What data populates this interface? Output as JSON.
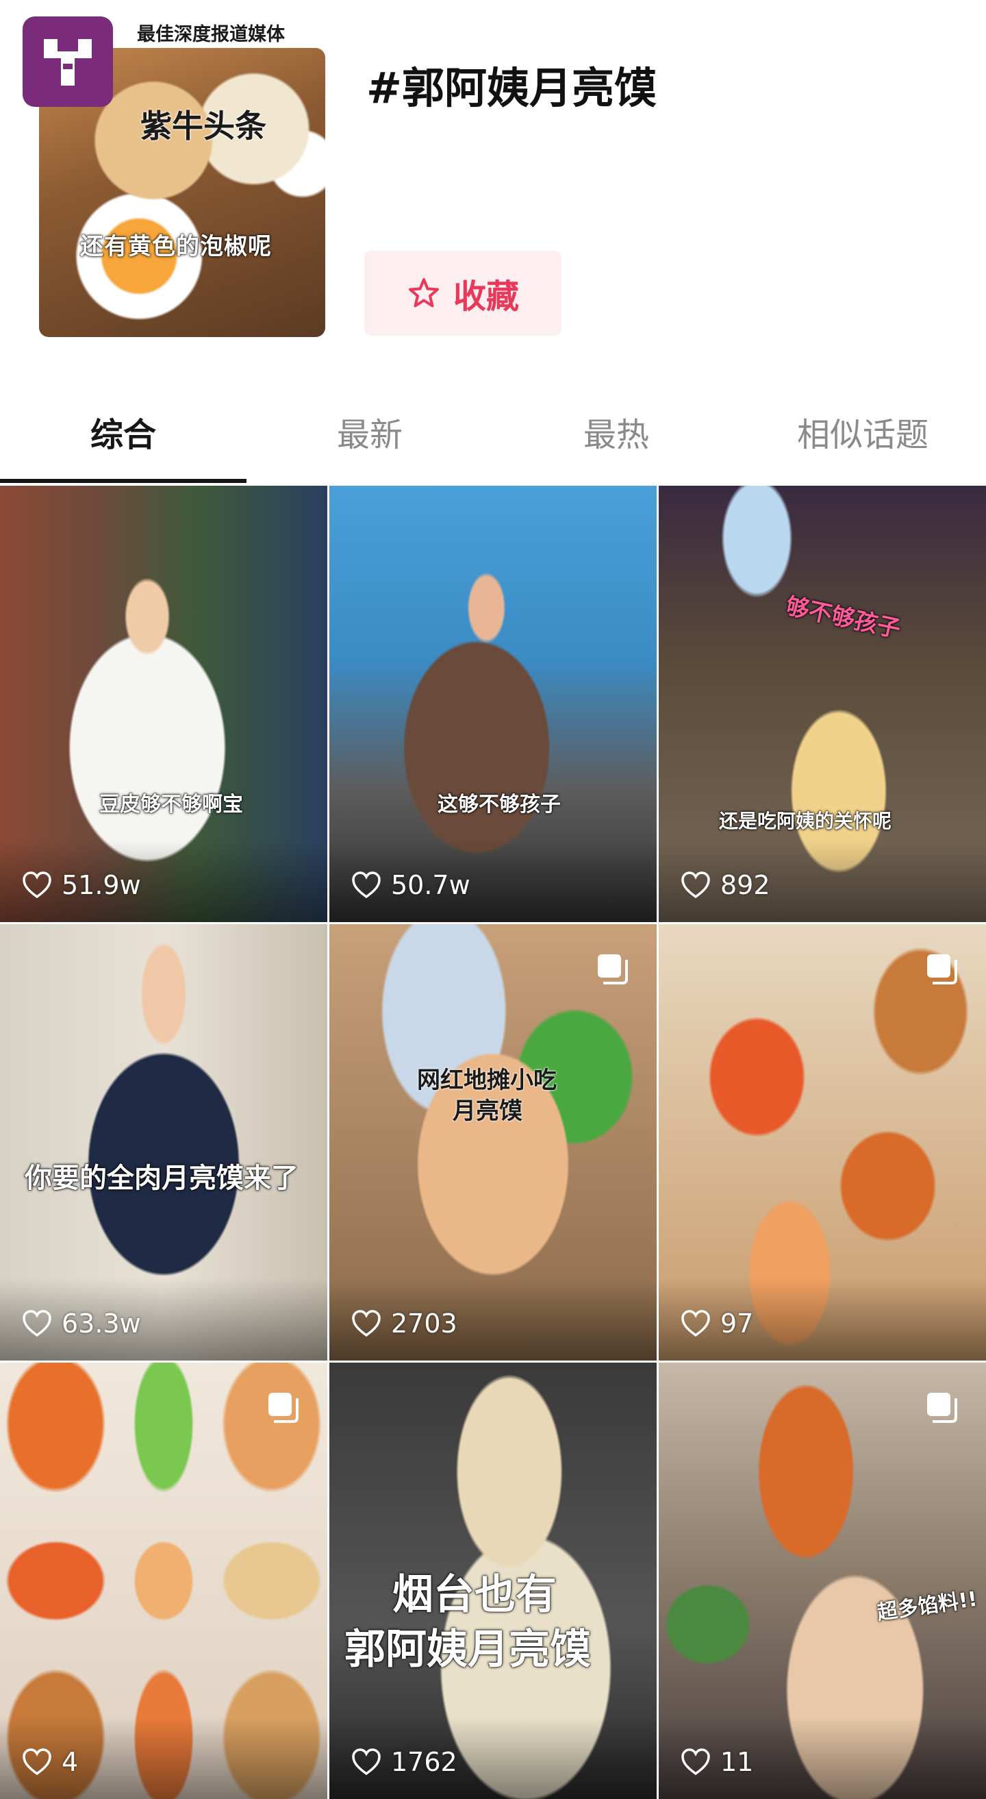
{
  "header": {
    "cover_caption": "还有黄色的泡椒呢",
    "brand_name": "紫牛头条",
    "brand_slogan": "最佳深度报道媒体",
    "hashtag": "#郭阿姨月亮馍",
    "favorite_label": "收藏"
  },
  "tabs": [
    {
      "label": "综合",
      "active": true
    },
    {
      "label": "最新",
      "active": false
    },
    {
      "label": "最热",
      "active": false
    },
    {
      "label": "相似话题",
      "active": false
    }
  ],
  "videos": [
    {
      "caption": "豆皮够不够啊宝",
      "likes": "51.9w",
      "multi": false
    },
    {
      "caption": "这够不够孩子",
      "likes": "50.7w",
      "multi": false
    },
    {
      "caption": "还是吃阿姨的关怀呢",
      "caption2": "够不够孩子",
      "likes": "892",
      "multi": false
    },
    {
      "caption": "你要的全肉月亮馍来了",
      "likes": "63.3w",
      "multi": false
    },
    {
      "caption": "网红地摊小吃",
      "caption2": "月亮馍",
      "likes": "2703",
      "multi": true
    },
    {
      "caption": "",
      "likes": "97",
      "multi": true
    },
    {
      "caption": "",
      "likes": "4",
      "multi": true
    },
    {
      "caption": "烟台也有",
      "caption2": "郭阿姨月亮馍",
      "likes": "1762",
      "multi": false
    },
    {
      "caption": "超多馅料!!",
      "likes": "11",
      "multi": true
    }
  ],
  "colors": {
    "accent": "#e8395a",
    "accent_bg": "#fdeef0",
    "brand": "#7a2b7a"
  }
}
